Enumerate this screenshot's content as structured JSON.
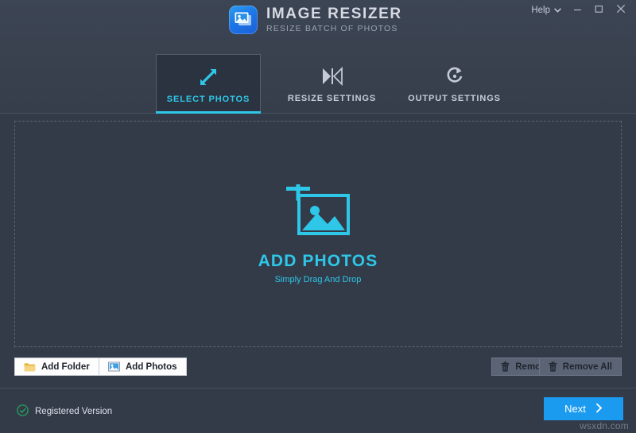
{
  "window": {
    "app_title": "IMAGE RESIZER",
    "app_subtitle": "RESIZE BATCH OF PHOTOS",
    "logo_icon": "image-stack-icon",
    "help_label": "Help",
    "help_chevron_icon": "chevron-down-icon",
    "minimize_icon": "minimize-icon",
    "maximize_icon": "maximize-icon",
    "close_icon": "close-icon",
    "colors": {
      "accent_cyan": "#2ec7e8",
      "accent_blue": "#1a9bf0",
      "header_bg": "#39414f",
      "body_bg": "#333b49",
      "active_tab_bg": "#2c3340",
      "dash_border": "#5b6476",
      "registered_green": "#23a45c"
    }
  },
  "tabs": [
    {
      "id": "select-photos",
      "label": "SELECT PHOTOS",
      "icon": "expand-arrows-icon",
      "active": true
    },
    {
      "id": "resize-settings",
      "label": "RESIZE SETTINGS",
      "icon": "collapse-arrows-icon",
      "active": false
    },
    {
      "id": "output-settings",
      "label": "OUTPUT SETTINGS",
      "icon": "refresh-rotate-icon",
      "active": false
    }
  ],
  "dropzone": {
    "icon": "add-photo-frame-icon",
    "title": "ADD PHOTOS",
    "subtitle": "Simply Drag And Drop"
  },
  "actions": {
    "add_folder": {
      "label": "Add Folder",
      "icon": "folder-icon"
    },
    "add_photos": {
      "label": "Add Photos",
      "icon": "picture-icon"
    },
    "remove": {
      "label": "Remove",
      "icon": "trash-icon"
    },
    "remove_all": {
      "label": "Remove All",
      "icon": "trash-icon"
    }
  },
  "footer": {
    "registered_label": "Registered Version",
    "registered_icon": "check-circle-icon",
    "next_label": "Next",
    "next_icon": "chevron-right-icon",
    "watermark": "wsxdn.com"
  }
}
